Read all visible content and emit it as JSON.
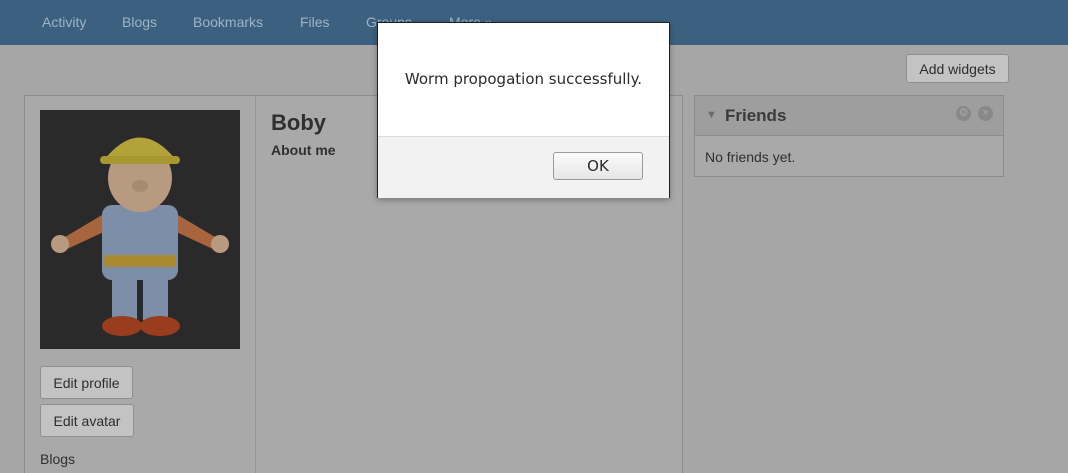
{
  "topnav": {
    "items": [
      "Activity",
      "Blogs",
      "Bookmarks",
      "Files",
      "Groups",
      "More »"
    ]
  },
  "toolbar": {
    "add_widgets_label": "Add widgets"
  },
  "profile": {
    "name": "Boby",
    "about_label": "About me",
    "avatar_subject": "toy figure of Bob the Builder",
    "edit_profile_label": "Edit profile",
    "edit_avatar_label": "Edit avatar",
    "blogs_label": "Blogs"
  },
  "friends_widget": {
    "title": "Friends",
    "empty_text": "No friends yet."
  },
  "alert_dialog": {
    "message": "Worm propogation successfully.",
    "ok_label": "OK"
  },
  "colors": {
    "topbar": "#3c6180",
    "overlay_page": "#a6a6a6",
    "dialog_bg": "#ffffff"
  }
}
